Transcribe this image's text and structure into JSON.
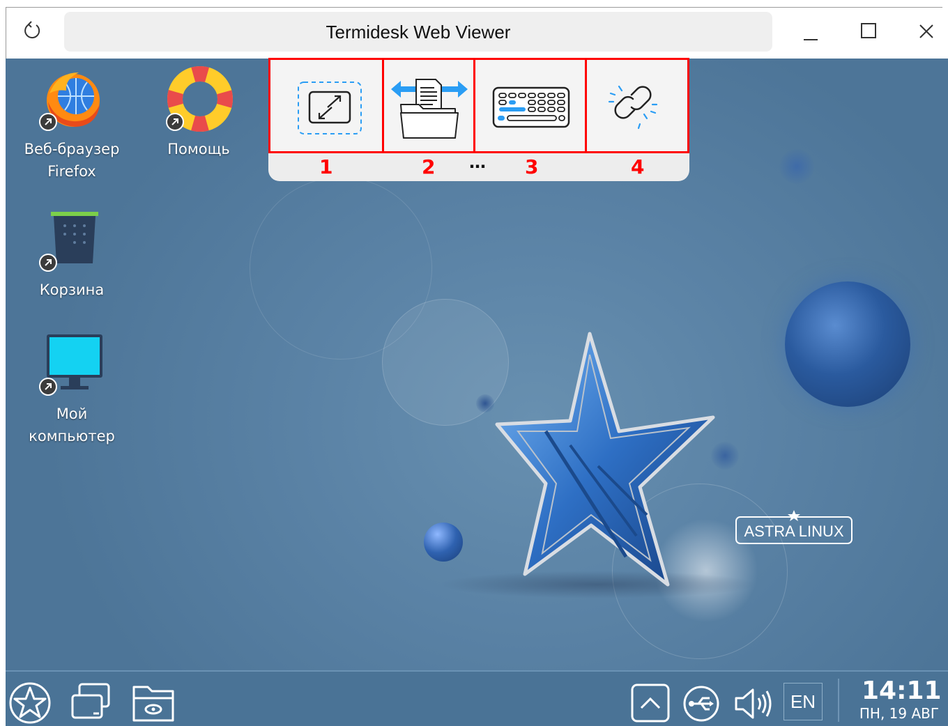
{
  "window": {
    "title": "Termidesk Web Viewer",
    "icons": {
      "reload": "reload-icon",
      "minimize": "minimize-icon",
      "maximize": "maximize-icon",
      "close": "close-icon"
    }
  },
  "desktop_icons": [
    {
      "label": "Веб-браузер Firefox",
      "icon": "firefox-icon"
    },
    {
      "label": "Помощь",
      "icon": "help-lifebuoy-icon"
    },
    {
      "label": "Корзина",
      "icon": "trash-icon"
    },
    {
      "label": "Мой компьютер",
      "icon": "computer-icon"
    }
  ],
  "toolbar": {
    "buttons": [
      {
        "number": "1",
        "icon": "fullscreen-icon"
      },
      {
        "number": "2",
        "icon": "file-transfer-icon"
      },
      {
        "number": "3",
        "icon": "keyboard-icon"
      },
      {
        "number": "4",
        "icon": "disconnect-link-icon"
      }
    ],
    "more": "…"
  },
  "wallpaper": {
    "logo_text": "ASTRA LINUX"
  },
  "taskbar": {
    "icons": [
      "start-menu-icon",
      "windows-switcher-icon",
      "file-manager-icon",
      "tray-expand-icon",
      "network-icon",
      "volume-icon"
    ],
    "language": "EN",
    "time": "14:11",
    "date": "ПН, 19 АВГ"
  },
  "colors": {
    "highlight": "#ff0000",
    "desktop": "#5b83a6",
    "taskbar": "#4a7396",
    "accent": "#2a9df4"
  }
}
